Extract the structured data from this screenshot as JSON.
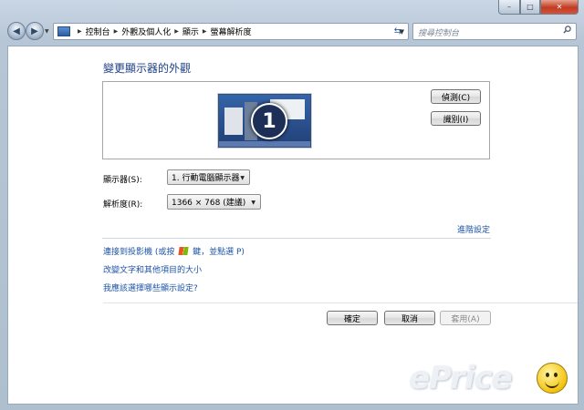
{
  "window": {
    "caption_min": "–",
    "caption_max": "□",
    "caption_close": "✕"
  },
  "navbar": {
    "breadcrumbs": [
      "控制台",
      "外觀及個人化",
      "顯示",
      "螢幕解析度"
    ],
    "search_placeholder": "搜尋控制台",
    "back_icon": "back-arrow-icon",
    "forward_icon": "forward-arrow-icon"
  },
  "main": {
    "title": "變更顯示器的外觀",
    "monitor_number": "1",
    "detect_button": "偵測(C)",
    "identify_button": "識別(I)",
    "display_label": "顯示器(S):",
    "display_value": "1. 行動電腦顯示器",
    "resolution_label": "解析度(R):",
    "resolution_value": "1366 × 768 (建議)",
    "advanced_link": "進階設定",
    "links": {
      "projector_prefix": "連接到投影機 (或按",
      "projector_suffix": "鍵，並點選 P)",
      "text_size": "改變文字和其他項目的大小",
      "which_settings": "我應該選擇哪些顯示設定?"
    }
  },
  "footer": {
    "ok_button": "確定",
    "cancel_button": "取消",
    "apply_button": "套用(A)"
  },
  "watermark": {
    "text": "ePrice"
  },
  "colors": {
    "title_blue": "#1e3f85",
    "link_blue": "#1e53a6",
    "close_red": "#c23b21"
  }
}
